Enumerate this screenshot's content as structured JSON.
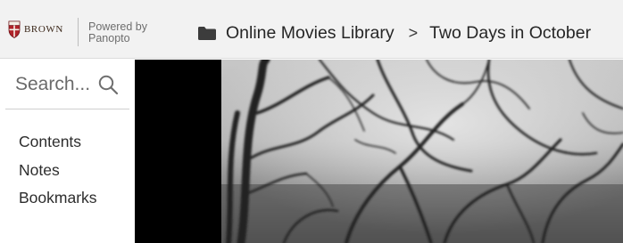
{
  "header": {
    "logo_text": "BROWN",
    "powered_line1": "Powered by",
    "powered_line2": "Panopto",
    "breadcrumb": {
      "folder_icon": "folder-icon",
      "folder": "Online Movies Library",
      "separator": ">",
      "current": "Two Days in October"
    }
  },
  "sidebar": {
    "search": {
      "placeholder": "Search...",
      "icon": "search-icon"
    },
    "nav": [
      {
        "label": "Contents"
      },
      {
        "label": "Notes"
      },
      {
        "label": "Bookmarks"
      }
    ]
  },
  "video": {
    "description_icon": "video-frame"
  },
  "colors": {
    "header_bg": "#f2f2f2",
    "video_bg": "#000000",
    "brown_red": "#b0232a"
  }
}
